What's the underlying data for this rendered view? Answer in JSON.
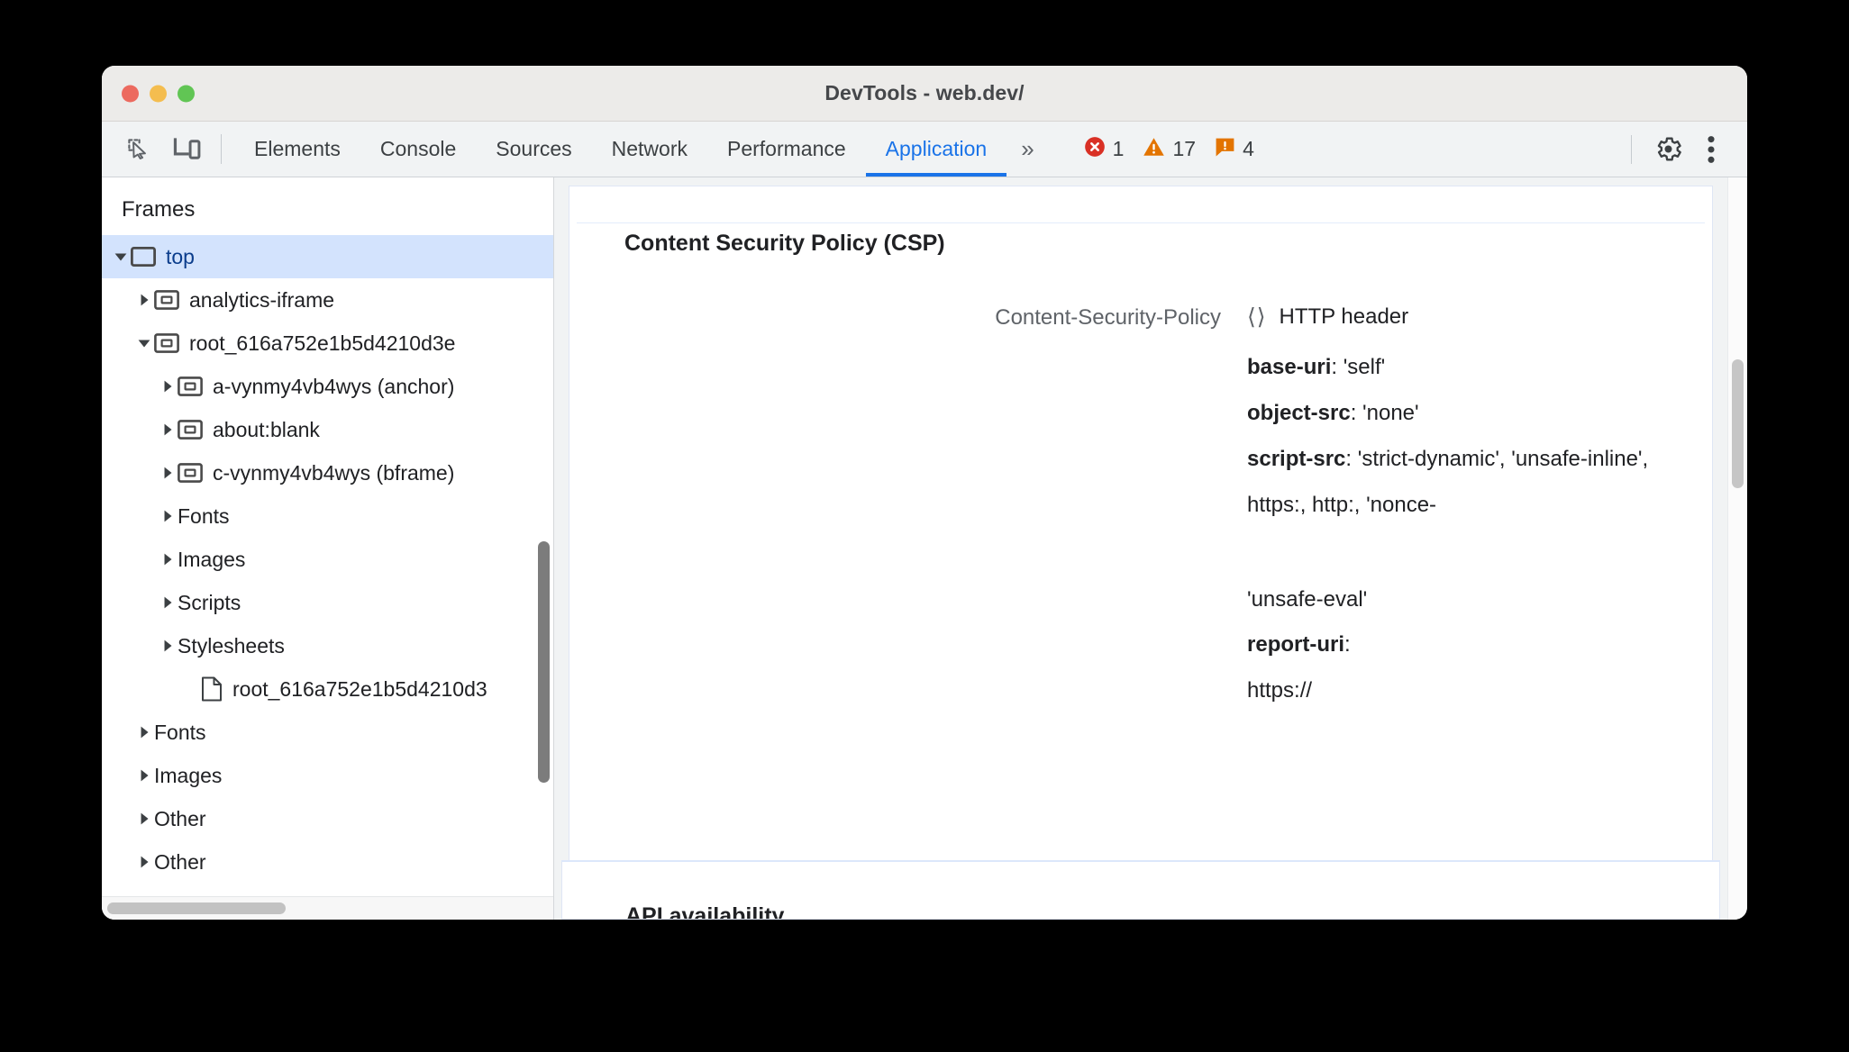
{
  "window": {
    "title": "DevTools - web.dev/",
    "traffic_lights": [
      "close",
      "minimize",
      "maximize"
    ]
  },
  "toolbar": {
    "inspect_icon": "inspect-element-icon",
    "device_icon": "device-toolbar-icon",
    "tabs": [
      {
        "label": "Elements",
        "active": false
      },
      {
        "label": "Console",
        "active": false
      },
      {
        "label": "Sources",
        "active": false
      },
      {
        "label": "Network",
        "active": false
      },
      {
        "label": "Performance",
        "active": false
      },
      {
        "label": "Application",
        "active": true
      }
    ],
    "more_tabs_label": "»",
    "status": {
      "errors": {
        "icon": "error-icon",
        "count": "1",
        "color": "#d93025"
      },
      "warnings": {
        "icon": "warning-icon",
        "count": "17",
        "color": "#e37400"
      },
      "issues": {
        "icon": "issue-icon",
        "count": "4",
        "color": "#e37400"
      }
    },
    "settings_icon": "gear-icon",
    "more_icon": "kebab-menu-icon"
  },
  "sidebar": {
    "header": "Frames",
    "tree": [
      {
        "label": "top",
        "depth": 0,
        "twisty": "down",
        "icon": "frame-top-icon",
        "selected": true
      },
      {
        "label": "analytics-iframe",
        "depth": 1,
        "twisty": "right",
        "icon": "iframe-icon",
        "selected": false
      },
      {
        "label": "root_616a752e1b5d4210d3e",
        "depth": 1,
        "twisty": "down",
        "icon": "iframe-icon",
        "selected": false
      },
      {
        "label": "a-vynmy4vb4wys (anchor)",
        "depth": 2,
        "twisty": "right",
        "icon": "iframe-icon",
        "selected": false
      },
      {
        "label": "about:blank",
        "depth": 2,
        "twisty": "right",
        "icon": "iframe-icon",
        "selected": false
      },
      {
        "label": "c-vynmy4vb4wys (bframe)",
        "depth": 2,
        "twisty": "right",
        "icon": "iframe-icon",
        "selected": false
      },
      {
        "label": "Fonts",
        "depth": 2,
        "twisty": "right",
        "icon": "none",
        "selected": false
      },
      {
        "label": "Images",
        "depth": 2,
        "twisty": "right",
        "icon": "none",
        "selected": false
      },
      {
        "label": "Scripts",
        "depth": 2,
        "twisty": "right",
        "icon": "none",
        "selected": false
      },
      {
        "label": "Stylesheets",
        "depth": 2,
        "twisty": "right",
        "icon": "none",
        "selected": false
      },
      {
        "label": "root_616a752e1b5d4210d3",
        "depth": 3,
        "twisty": "none",
        "icon": "document-icon",
        "selected": false
      },
      {
        "label": "Fonts",
        "depth": 1,
        "twisty": "right",
        "icon": "none",
        "selected": false
      },
      {
        "label": "Images",
        "depth": 1,
        "twisty": "right",
        "icon": "none",
        "selected": false
      },
      {
        "label": "Other",
        "depth": 1,
        "twisty": "right",
        "icon": "none",
        "selected": false
      },
      {
        "label": "Other",
        "depth": 1,
        "twisty": "right",
        "icon": "none",
        "selected": false
      }
    ],
    "vertical_scrollbar": "sidebar-vertical-scrollbar",
    "horizontal_scrollbar": "sidebar-horizontal-scrollbar"
  },
  "main": {
    "csp": {
      "title": "Content Security Policy (CSP)",
      "source_label": "Content-Security-Policy",
      "source_kind_icon": "code-brackets-icon",
      "source_kind": "HTTP header",
      "directives": [
        {
          "name": "base-uri",
          "value": "'self'"
        },
        {
          "name": "object-src",
          "value": "'none'"
        },
        {
          "name": "script-src",
          "value": "'strict-dynamic', 'unsafe-inline',"
        }
      ],
      "wrapped_lines": [
        "https:, http:, 'nonce-",
        "'unsafe-eval'"
      ],
      "report_directive": {
        "name": "report-uri",
        "value": ""
      },
      "report_value_line": "https://"
    },
    "next_section_title": "API availability",
    "vertical_scrollbar": "main-vertical-scrollbar"
  }
}
